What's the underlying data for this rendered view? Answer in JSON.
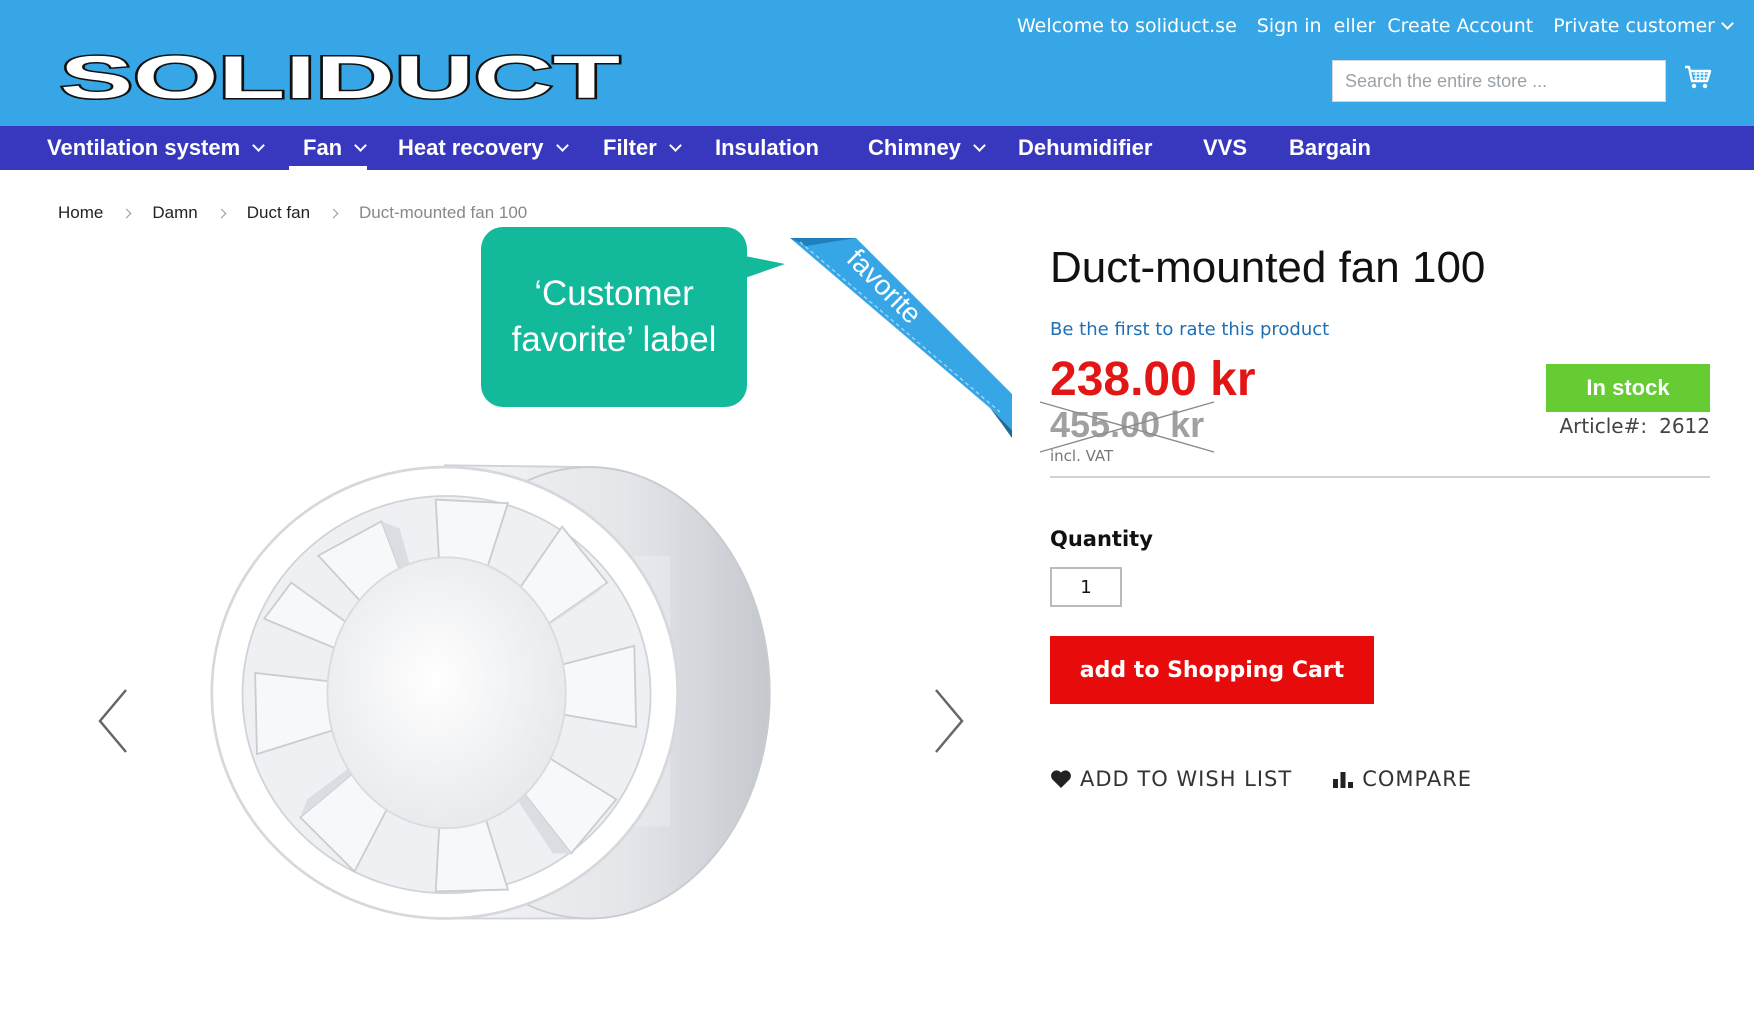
{
  "header": {
    "welcome": "Welcome to soliduct.se",
    "sign_in": "Sign in",
    "or": "eller",
    "create_account": "Create Account",
    "customer_type": "Private customer",
    "logo_text": "SOLIDUCT",
    "search_placeholder": "Search the entire store ...",
    "cart_icon": "shopping-cart-icon",
    "background_color": "#37a6e6"
  },
  "nav": {
    "background_color": "#3838be",
    "items": [
      {
        "label": "Ventilation system",
        "has_dropdown": true
      },
      {
        "label": "Fan",
        "has_dropdown": true,
        "active": true
      },
      {
        "label": "Heat recovery",
        "has_dropdown": true
      },
      {
        "label": "Filter",
        "has_dropdown": true
      },
      {
        "label": "Insulation",
        "has_dropdown": false
      },
      {
        "label": "Chimney",
        "has_dropdown": true
      },
      {
        "label": "Dehumidifier",
        "has_dropdown": false
      },
      {
        "label": "VVS",
        "has_dropdown": false
      },
      {
        "label": "Bargain",
        "has_dropdown": false
      }
    ]
  },
  "breadcrumb": [
    "Home",
    "Damn",
    "Duct fan",
    "Duct-mounted fan 100"
  ],
  "gallery": {
    "callout_text": "‘Customer favorite’ label",
    "ribbon_text": "Customer favorite",
    "callout_color": "#13b99b",
    "ribbon_color": "#37a6e6"
  },
  "product": {
    "title": "Duct-mounted fan 100",
    "rating_link": "Be the first to rate this product",
    "price": "238.00 kr",
    "old_price": "455.00 kr",
    "vat_note": "incl. VAT",
    "stock": "In stock",
    "article_label": "Article#:",
    "article_number": "2612",
    "quantity_label": "Quantity",
    "quantity_value": "1",
    "add_to_cart": "add to Shopping Cart",
    "wishlist": "ADD TO WISH LIST",
    "compare": "COMPARE",
    "price_color": "#e31616",
    "stock_color": "#66cc33",
    "cart_button_color": "#e80b0b"
  }
}
